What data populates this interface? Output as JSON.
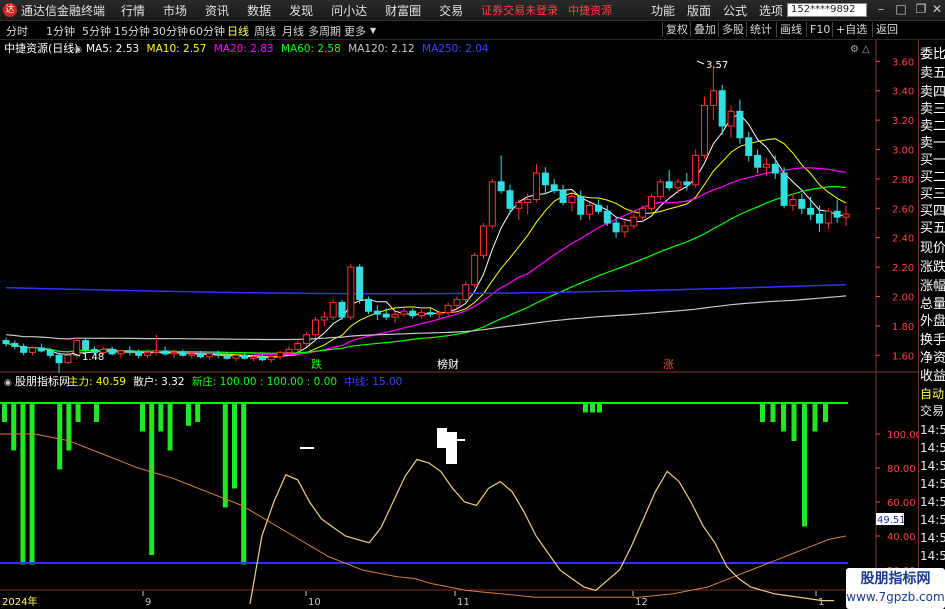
{
  "titlebar": {
    "app_name": "通达信金融终端",
    "menus": [
      "行情",
      "市场",
      "资讯",
      "数据",
      "发现",
      "问小达",
      "财富圈",
      "交易"
    ],
    "warn1": "证券交易未登录",
    "warn2": "中捷资源",
    "tools": [
      "功能",
      "版面",
      "公式",
      "选项"
    ],
    "user": "152****9892"
  },
  "periods": [
    "分时",
    "1分钟",
    "5分钟",
    "15分钟",
    "30分钟",
    "60分钟",
    "日线",
    "周线",
    "月线",
    "多周期",
    "更多"
  ],
  "active_period": "日线",
  "right_buttons": [
    "复权",
    "叠加",
    "多股",
    "统计",
    "画线",
    "F10",
    "+自选",
    "返回"
  ],
  "main_legend": {
    "stock": "中捷资源(日线)",
    "items": [
      {
        "label": "MA5: 2.53",
        "color": "#ffffff"
      },
      {
        "label": "MA10: 2.57",
        "color": "#ffff00"
      },
      {
        "label": "MA20: 2.83",
        "color": "#ff00ff"
      },
      {
        "label": "MA60: 2.58",
        "color": "#00ff00"
      },
      {
        "label": "MA120: 2.12",
        "color": "#c8c8c8"
      },
      {
        "label": "MA250: 2.04",
        "color": "#4040ff"
      }
    ]
  },
  "price_axis": [
    "3.60",
    "3.40",
    "3.20",
    "3.00",
    "2.80",
    "2.60",
    "2.40",
    "2.20",
    "2.00",
    "1.80",
    "1.60"
  ],
  "price_high_label": "3.57",
  "price_low_label": "1.48",
  "event_markers": [
    {
      "text": "跌",
      "color": "#00ff00"
    },
    {
      "text": "榜财",
      "color": "#ffffff"
    },
    {
      "text": "涨",
      "color": "#ff4040"
    }
  ],
  "indicator_legend": {
    "name": "股朋指标网",
    "items": [
      {
        "label": "主力: 40.59",
        "color": "#ffff00"
      },
      {
        "label": "散户: 3.32",
        "color": "#ffffff"
      },
      {
        "label": "新庄: 100.00 : 100.00 : 0.00",
        "color": "#00ff00"
      },
      {
        "label": "中线: 15.00",
        "color": "#4040ff"
      }
    ]
  },
  "indicator_axis": [
    "100.00",
    "80.00",
    "60.00",
    "40.00",
    "20.00"
  ],
  "indicator_current": "49.51",
  "date_axis": [
    "2024年",
    "9",
    "10",
    "11",
    "12",
    "1"
  ],
  "sidebar_quote": [
    "委比",
    "卖五",
    "卖四",
    "卖三",
    "卖二",
    "卖一",
    "买一",
    "买二",
    "买三",
    "买四",
    "买五",
    "现价",
    "涨跌",
    "涨幅",
    "总量",
    "外盘",
    "换手",
    "净资",
    "收益"
  ],
  "sidebar_trade": [
    "自动",
    "交易",
    "14:56",
    "14:56",
    "14:56",
    "14:56",
    "14:56",
    "14:56",
    "14:56",
    "14:56",
    "14:56",
    "14:56"
  ],
  "badge": {
    "line1": "股朋指标网",
    "line2": "www.7gpzb.com"
  },
  "chart_data": {
    "type": "candlestick",
    "ylim": [
      1.5,
      3.65
    ],
    "candles": [
      [
        1.7,
        1.72,
        1.66,
        1.68
      ],
      [
        1.68,
        1.7,
        1.64,
        1.66
      ],
      [
        1.66,
        1.68,
        1.6,
        1.62
      ],
      [
        1.62,
        1.66,
        1.6,
        1.65
      ],
      [
        1.65,
        1.68,
        1.62,
        1.63
      ],
      [
        1.63,
        1.65,
        1.58,
        1.6
      ],
      [
        1.6,
        1.62,
        1.48,
        1.55
      ],
      [
        1.55,
        1.62,
        1.54,
        1.6
      ],
      [
        1.6,
        1.72,
        1.58,
        1.7
      ],
      [
        1.7,
        1.72,
        1.62,
        1.64
      ],
      [
        1.64,
        1.66,
        1.6,
        1.62
      ],
      [
        1.62,
        1.66,
        1.6,
        1.64
      ],
      [
        1.64,
        1.66,
        1.6,
        1.61
      ],
      [
        1.61,
        1.64,
        1.58,
        1.63
      ],
      [
        1.63,
        1.66,
        1.6,
        1.62
      ],
      [
        1.62,
        1.64,
        1.58,
        1.6
      ],
      [
        1.6,
        1.64,
        1.58,
        1.62
      ],
      [
        1.62,
        1.74,
        1.6,
        1.63
      ],
      [
        1.63,
        1.66,
        1.6,
        1.61
      ],
      [
        1.61,
        1.64,
        1.58,
        1.62
      ],
      [
        1.62,
        1.64,
        1.59,
        1.6
      ],
      [
        1.6,
        1.63,
        1.58,
        1.61
      ],
      [
        1.61,
        1.63,
        1.58,
        1.59
      ],
      [
        1.59,
        1.62,
        1.57,
        1.61
      ],
      [
        1.61,
        1.63,
        1.58,
        1.6
      ],
      [
        1.6,
        1.62,
        1.57,
        1.58
      ],
      [
        1.58,
        1.61,
        1.56,
        1.6
      ],
      [
        1.6,
        1.62,
        1.57,
        1.58
      ],
      [
        1.58,
        1.6,
        1.56,
        1.59
      ],
      [
        1.59,
        1.61,
        1.56,
        1.57
      ],
      [
        1.57,
        1.6,
        1.55,
        1.59
      ],
      [
        1.59,
        1.63,
        1.57,
        1.62
      ],
      [
        1.62,
        1.66,
        1.6,
        1.64
      ],
      [
        1.64,
        1.7,
        1.62,
        1.68
      ],
      [
        1.68,
        1.76,
        1.66,
        1.74
      ],
      [
        1.74,
        1.86,
        1.72,
        1.84
      ],
      [
        1.84,
        1.9,
        1.8,
        1.86
      ],
      [
        1.86,
        1.98,
        1.84,
        1.96
      ],
      [
        1.96,
        1.98,
        1.84,
        1.86
      ],
      [
        1.86,
        2.22,
        1.84,
        2.2
      ],
      [
        2.2,
        2.22,
        1.95,
        1.98
      ],
      [
        1.98,
        2.0,
        1.88,
        1.9
      ],
      [
        1.9,
        1.94,
        1.84,
        1.88
      ],
      [
        1.88,
        1.92,
        1.84,
        1.86
      ],
      [
        1.86,
        1.9,
        1.82,
        1.88
      ],
      [
        1.88,
        1.92,
        1.86,
        1.9
      ],
      [
        1.9,
        1.92,
        1.85,
        1.87
      ],
      [
        1.87,
        1.91,
        1.85,
        1.89
      ],
      [
        1.89,
        1.92,
        1.86,
        1.88
      ],
      [
        1.88,
        1.9,
        1.85,
        1.89
      ],
      [
        1.89,
        1.96,
        1.87,
        1.94
      ],
      [
        1.94,
        2.0,
        1.92,
        1.98
      ],
      [
        1.98,
        2.1,
        1.96,
        2.08
      ],
      [
        2.08,
        2.3,
        2.06,
        2.28
      ],
      [
        2.28,
        2.5,
        2.26,
        2.48
      ],
      [
        2.48,
        2.8,
        2.46,
        2.78
      ],
      [
        2.78,
        2.96,
        2.7,
        2.72
      ],
      [
        2.72,
        2.76,
        2.56,
        2.6
      ],
      [
        2.6,
        2.66,
        2.52,
        2.64
      ],
      [
        2.64,
        2.7,
        2.56,
        2.66
      ],
      [
        2.66,
        2.9,
        2.64,
        2.84
      ],
      [
        2.84,
        2.88,
        2.7,
        2.76
      ],
      [
        2.76,
        2.8,
        2.7,
        2.72
      ],
      [
        2.72,
        2.76,
        2.62,
        2.64
      ],
      [
        2.64,
        2.7,
        2.58,
        2.68
      ],
      [
        2.68,
        2.72,
        2.52,
        2.56
      ],
      [
        2.56,
        2.64,
        2.52,
        2.62
      ],
      [
        2.62,
        2.66,
        2.56,
        2.58
      ],
      [
        2.58,
        2.62,
        2.48,
        2.5
      ],
      [
        2.5,
        2.54,
        2.4,
        2.44
      ],
      [
        2.44,
        2.52,
        2.4,
        2.48
      ],
      [
        2.48,
        2.56,
        2.46,
        2.54
      ],
      [
        2.54,
        2.62,
        2.52,
        2.6
      ],
      [
        2.6,
        2.7,
        2.58,
        2.68
      ],
      [
        2.68,
        2.8,
        2.66,
        2.78
      ],
      [
        2.78,
        2.86,
        2.72,
        2.74
      ],
      [
        2.74,
        2.8,
        2.7,
        2.78
      ],
      [
        2.78,
        2.84,
        2.72,
        2.76
      ],
      [
        2.76,
        3.0,
        2.74,
        2.96
      ],
      [
        2.96,
        3.36,
        2.94,
        3.3
      ],
      [
        3.3,
        3.57,
        3.2,
        3.4
      ],
      [
        3.4,
        3.44,
        3.1,
        3.16
      ],
      [
        3.16,
        3.3,
        3.08,
        3.26
      ],
      [
        3.26,
        3.34,
        3.04,
        3.08
      ],
      [
        3.08,
        3.12,
        2.92,
        2.96
      ],
      [
        2.96,
        3.0,
        2.84,
        2.88
      ],
      [
        2.88,
        2.94,
        2.82,
        2.9
      ],
      [
        2.9,
        2.96,
        2.8,
        2.84
      ],
      [
        2.84,
        2.88,
        2.6,
        2.62
      ],
      [
        2.62,
        2.7,
        2.58,
        2.66
      ],
      [
        2.66,
        2.7,
        2.56,
        2.6
      ],
      [
        2.6,
        2.68,
        2.52,
        2.56
      ],
      [
        2.56,
        2.62,
        2.44,
        2.5
      ],
      [
        2.5,
        2.6,
        2.46,
        2.58
      ],
      [
        2.58,
        2.66,
        2.5,
        2.54
      ],
      [
        2.54,
        2.62,
        2.48,
        2.56
      ]
    ],
    "indicator": {
      "ylim": [
        0,
        110
      ],
      "green_top_bars": [
        [
          0,
          10
        ],
        [
          1,
          25
        ],
        [
          2,
          85
        ],
        [
          3,
          85
        ],
        [
          6,
          35
        ],
        [
          7,
          25
        ],
        [
          8,
          10
        ],
        [
          10,
          10
        ],
        [
          15,
          15
        ],
        [
          16,
          80
        ],
        [
          17,
          15
        ],
        [
          18,
          25
        ],
        [
          20,
          12
        ],
        [
          21,
          10
        ],
        [
          24,
          55
        ],
        [
          25,
          45
        ],
        [
          26,
          85
        ],
        [
          41,
          5
        ],
        [
          42,
          5
        ],
        [
          43,
          5
        ],
        [
          56,
          10
        ],
        [
          57,
          10
        ],
        [
          58,
          15
        ],
        [
          59,
          20
        ],
        [
          60,
          65
        ],
        [
          61,
          15
        ],
        [
          62,
          10
        ]
      ],
      "main_line": [
        0,
        0,
        0,
        0,
        0,
        0,
        0,
        0,
        0,
        0,
        0,
        0,
        0,
        0,
        0,
        0,
        0,
        0,
        0,
        0,
        0,
        40,
        60,
        76,
        73,
        60,
        50,
        45,
        40,
        38,
        36,
        45,
        60,
        75,
        85,
        83,
        78,
        68,
        60,
        58,
        68,
        72,
        66,
        54,
        40,
        30,
        20,
        15,
        10,
        8,
        14,
        20,
        34,
        50,
        66,
        78,
        72,
        60,
        46,
        36,
        22,
        15,
        10,
        8,
        6,
        5,
        4,
        3,
        2,
        2
      ],
      "retail_line": [
        100,
        100,
        100,
        98,
        96,
        92,
        88,
        84,
        80,
        77,
        74,
        70,
        66,
        62,
        58,
        52,
        46,
        40,
        34,
        28,
        24,
        20,
        18,
        16,
        15,
        12,
        10,
        8,
        7,
        6,
        5,
        4,
        4,
        4,
        4,
        4,
        4,
        4,
        5,
        6,
        8,
        10,
        14,
        18,
        22,
        26,
        30,
        34,
        38,
        40
      ]
    }
  }
}
